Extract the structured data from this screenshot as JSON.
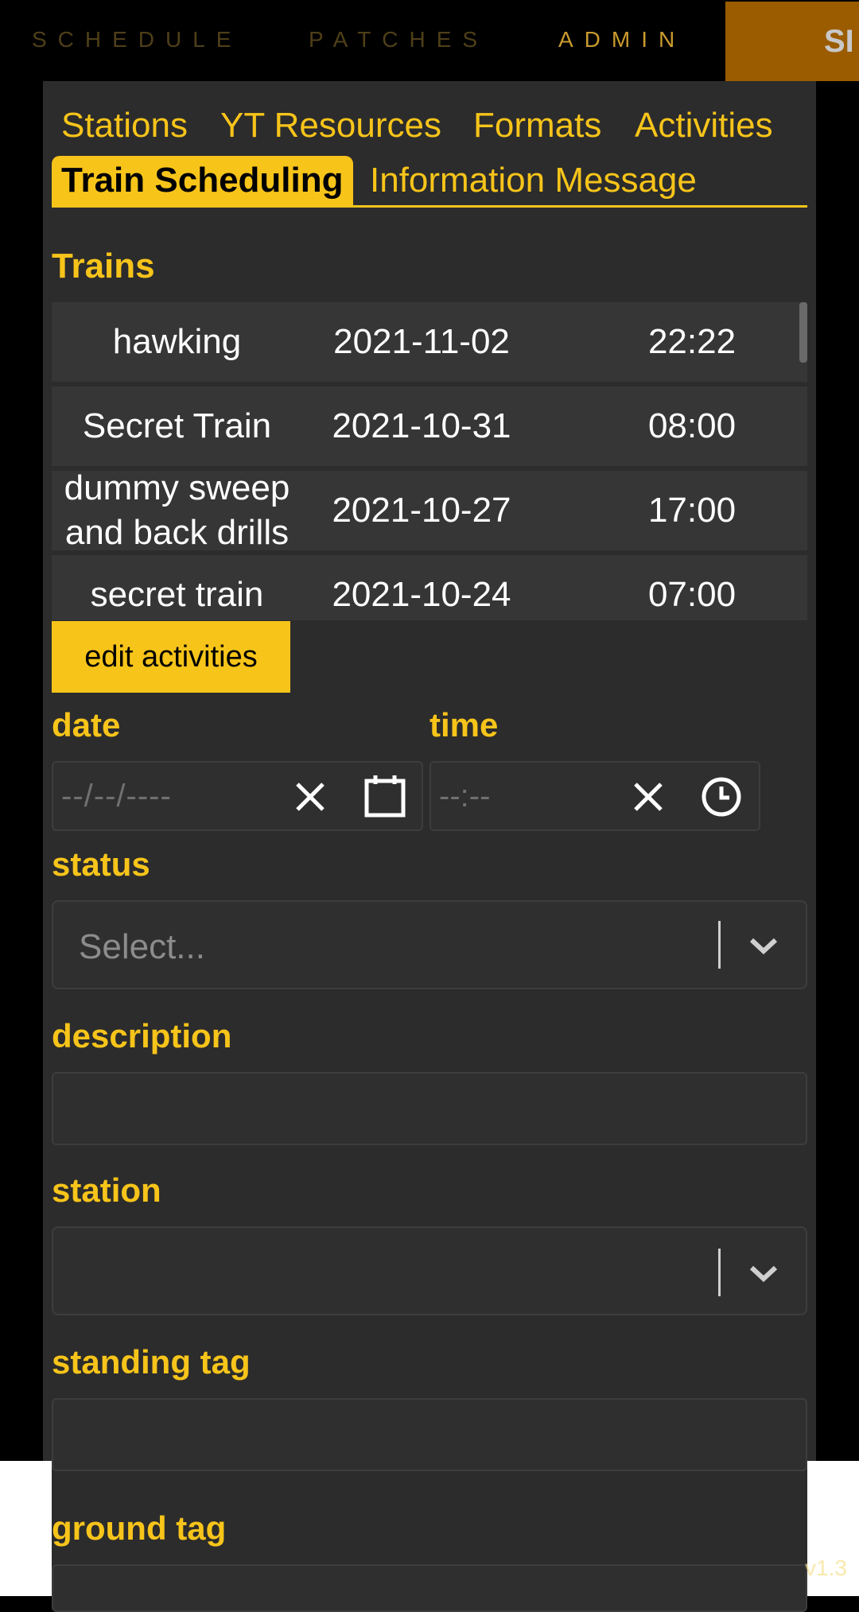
{
  "nav": {
    "schedule": "SCHEDULE",
    "patches": "PATCHES",
    "admin": "ADMIN",
    "sign_button": "SI"
  },
  "tabs": [
    {
      "label": "Stations"
    },
    {
      "label": "YT Resources"
    },
    {
      "label": "Formats"
    },
    {
      "label": "Activities"
    },
    {
      "label": "Train Scheduling"
    },
    {
      "label": "Information Message"
    }
  ],
  "active_tab": "Train Scheduling",
  "trains": {
    "heading": "Trains",
    "rows": [
      {
        "name": "hawking",
        "date": "2021-11-02",
        "time": "22:22"
      },
      {
        "name": "Secret Train",
        "date": "2021-10-31",
        "time": "08:00"
      },
      {
        "name": "dummy sweep and back drills",
        "date": "2021-10-27",
        "time": "17:00"
      },
      {
        "name": "secret train",
        "date": "2021-10-24",
        "time": "07:00"
      }
    ]
  },
  "edit_button": "edit activities",
  "form": {
    "date_label": "date",
    "date_placeholder": "--/--/----",
    "time_label": "time",
    "time_placeholder": "--:--",
    "status_label": "status",
    "status_placeholder": "Select...",
    "description_label": "description",
    "station_label": "station",
    "standing_tag_label": "standing tag",
    "ground_tag_label": "ground tag"
  },
  "version": "v1.3",
  "colors": {
    "accent": "#f7c41a",
    "panel": "#2c2c2c",
    "sign_button": "#9b5c00"
  }
}
